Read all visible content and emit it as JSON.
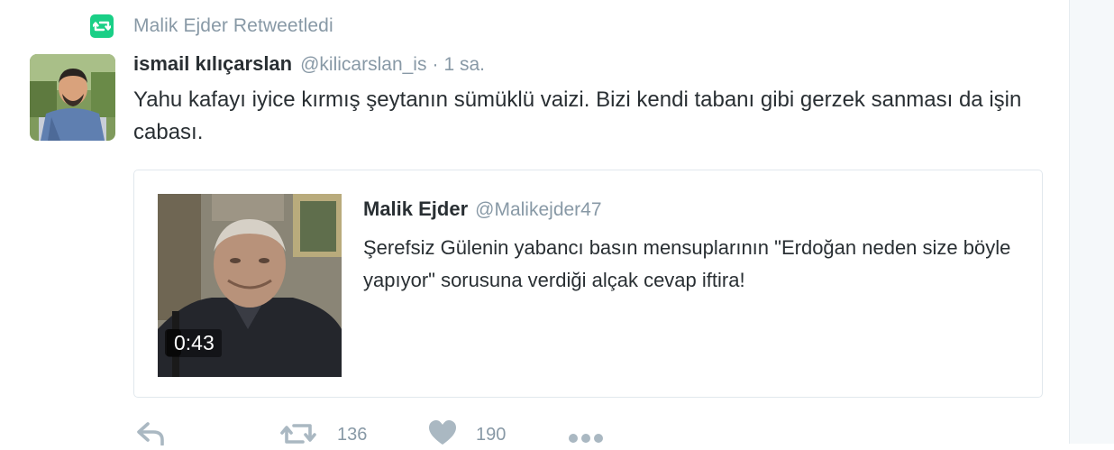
{
  "retweet_context": {
    "text": "Malik Ejder Retweetledi",
    "icon": "retweet-icon",
    "color": "#19cf86"
  },
  "tweet": {
    "fullname": "ismail kılıçarslan",
    "username": "@kilicarslan_is",
    "separator": "·",
    "time": "1 sa.",
    "text": "Yahu kafayı iyice kırmış şeytanın sümüklü vaizi. Bizi kendi tabanı gibi gerzek sanması da işin cabası."
  },
  "quoted": {
    "fullname": "Malik Ejder",
    "username": "@Malikejder47",
    "text": "Şerefsiz Gülenin yabancı basın mensuplarının \"Erdoğan neden size böyle yapıyor\" sorusuna verdiği alçak cevap iftira!",
    "video_duration": "0:43"
  },
  "actions": {
    "reply_icon": "reply-icon",
    "retweet_icon": "retweet-icon",
    "retweet_count": "136",
    "like_icon": "heart-icon",
    "like_count": "190",
    "more_icon": "more-icon"
  },
  "colors": {
    "text": "#292f33",
    "secondary": "#8899a6",
    "border": "#e1e8ed"
  }
}
